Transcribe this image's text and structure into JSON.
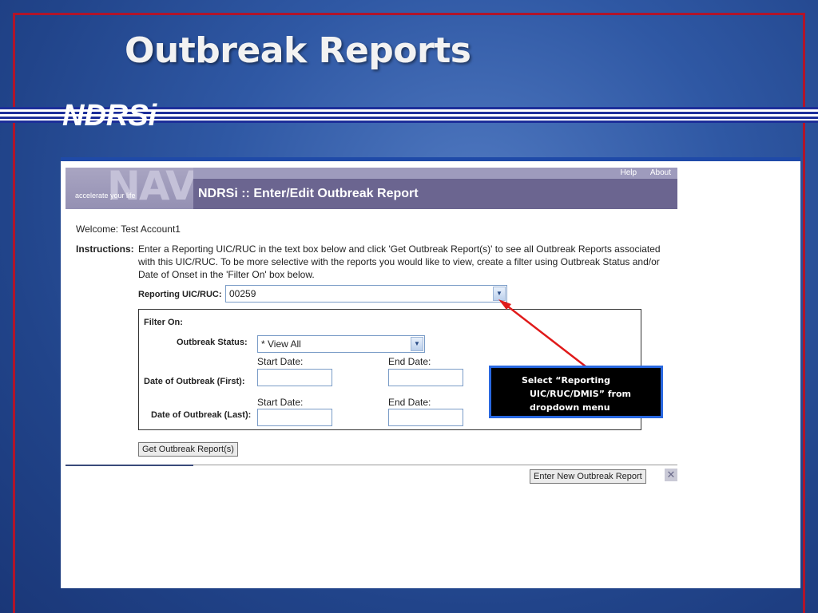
{
  "slide": {
    "title": "Outbreak Reports",
    "subtitle": "NDRSi"
  },
  "app": {
    "logo_text": "NAVY",
    "logo_tagline": "accelerate your life",
    "header_links": [
      "Help",
      "About"
    ],
    "page_title": "NDRSi :: Enter/Edit Outbreak Report"
  },
  "form": {
    "welcome": "Welcome: Test Account1",
    "instructions_label": "Instructions:",
    "instructions_text": "Enter a Reporting UIC/RUC in the text box below and click 'Get Outbreak Report(s)' to see all Outbreak Reports associated with this UIC/RUC. To be more selective with the reports you would like to view, create a filter using Outbreak Status and/or Date of Onset in the 'Filter On' box below.",
    "uic_label": "Reporting UIC/RUC:",
    "uic_value": "00259",
    "filter": {
      "title": "Filter On:",
      "status_label": "Outbreak Status:",
      "status_value": "* View All",
      "first_label": "Date of Outbreak (First):",
      "last_label": "Date of Outbreak (Last):",
      "start_date_label": "Start Date:",
      "end_date_label": "End Date:"
    },
    "get_button": "Get Outbreak Report(s)",
    "new_button": "Enter New Outbreak Report"
  },
  "callout": {
    "line1": "Select “Reporting",
    "line2": "UIC/RUC/DMIS” from",
    "line3": "dropdown menu"
  },
  "colors": {
    "frame_red": "#b0152b",
    "header_purple": "#6b6590",
    "callout_border": "#2968e0",
    "arrow_red": "#e01a1a"
  }
}
